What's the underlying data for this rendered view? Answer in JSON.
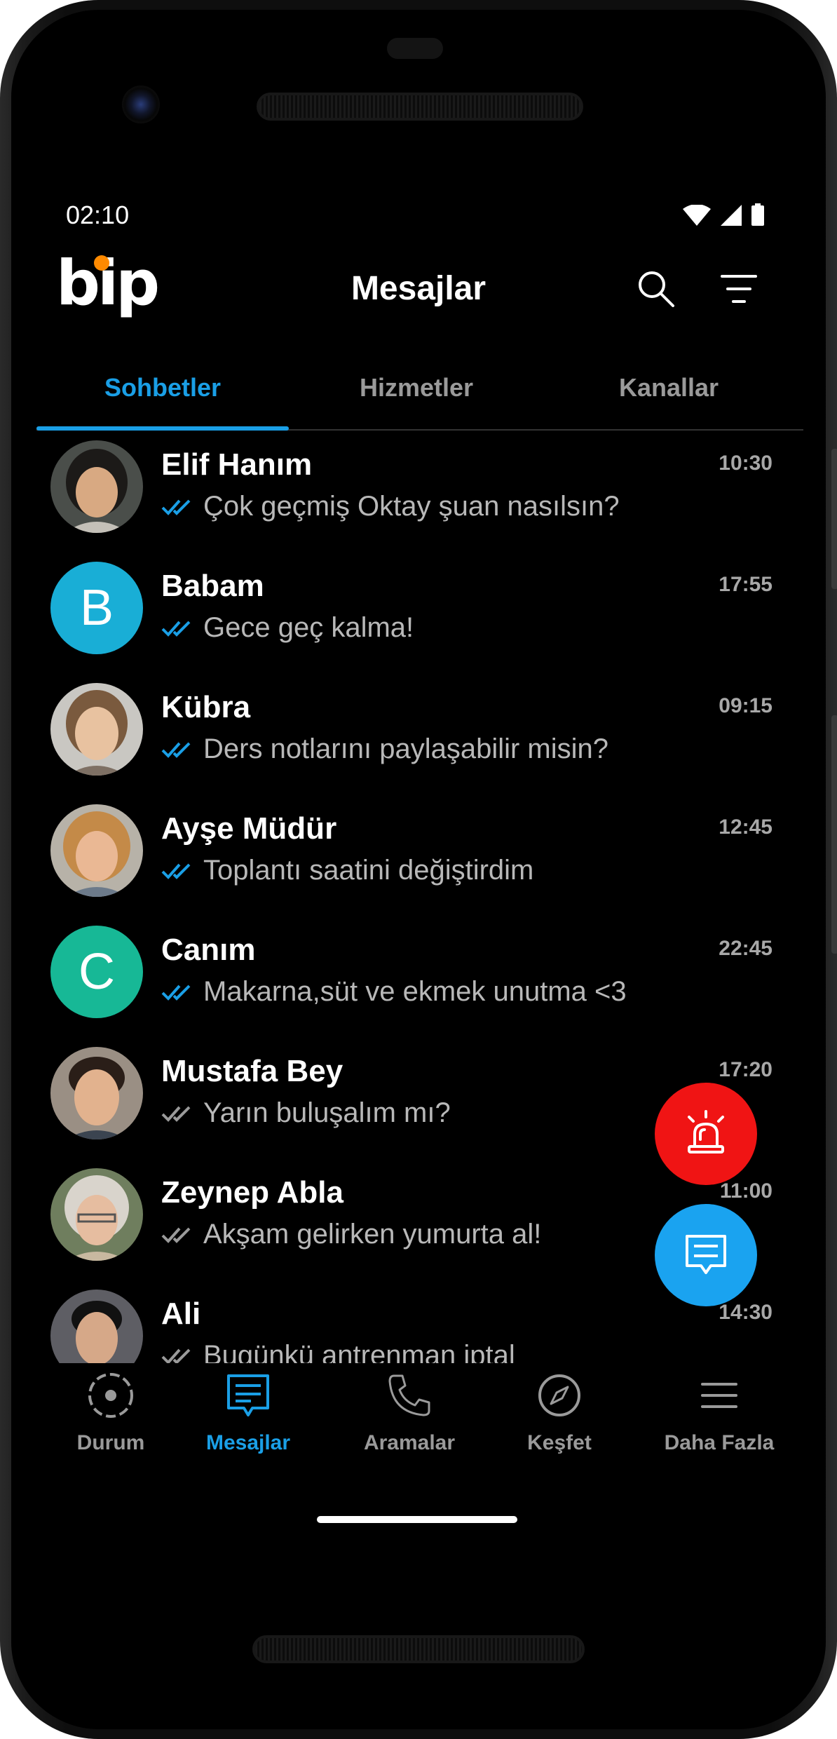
{
  "status_bar": {
    "time": "02:10",
    "icons": [
      "wifi-icon",
      "signal-icon",
      "battery-icon"
    ]
  },
  "header": {
    "logo_text": "bip",
    "title": "Mesajlar",
    "icons": [
      "search-icon",
      "filter-icon"
    ]
  },
  "tabs": [
    {
      "label": "Sohbetler",
      "active": true
    },
    {
      "label": "Hizmetler",
      "active": false
    },
    {
      "label": "Kanallar",
      "active": false
    }
  ],
  "chats": [
    {
      "name": "Elif Hanım",
      "time": "10:30",
      "preview": "Çok geçmiş Oktay şuan nasılsın?",
      "read": true,
      "avatar": "photo"
    },
    {
      "name": "Babam",
      "time": "17:55",
      "preview": "Gece geç kalma!",
      "read": true,
      "avatar_letter": "B",
      "avatar_color": "#19aed6"
    },
    {
      "name": "Kübra",
      "time": "09:15",
      "preview": "Ders notlarını paylaşabilir misin?",
      "read": true,
      "avatar": "photo"
    },
    {
      "name": "Ayşe Müdür",
      "time": "12:45",
      "preview": "Toplantı saatini değiştirdim",
      "read": true,
      "avatar": "photo"
    },
    {
      "name": "Canım",
      "time": "22:45",
      "preview": "Makarna,süt ve ekmek unutma <3",
      "read": true,
      "avatar_letter": "C",
      "avatar_color": "#17b896"
    },
    {
      "name": "Mustafa Bey",
      "time": "17:20",
      "preview": "Yarın buluşalım mı?",
      "read": false,
      "avatar": "photo"
    },
    {
      "name": "Zeynep Abla",
      "time": "11:00",
      "preview": "Akşam gelirken yumurta al!",
      "read": false,
      "avatar": "photo"
    },
    {
      "name": "Ali",
      "time": "14:30",
      "preview": "Bugünkü antrenman iptal",
      "read": false,
      "avatar": "photo"
    }
  ],
  "fabs": {
    "alert_color": "#f01414",
    "new_message_color": "#1aa3f0"
  },
  "bottom_nav": [
    {
      "label": "Durum",
      "icon": "status-icon",
      "active": false
    },
    {
      "label": "Mesajlar",
      "icon": "messages-icon",
      "active": true
    },
    {
      "label": "Aramalar",
      "icon": "phone-icon",
      "active": false
    },
    {
      "label": "Keşfet",
      "icon": "compass-icon",
      "active": false
    },
    {
      "label": "Daha Fazla",
      "icon": "menu-icon",
      "active": false
    }
  ],
  "colors": {
    "accent": "#1a9fe6",
    "read_tick": "#1a9fe6",
    "unread_tick": "#9a9a9a"
  }
}
